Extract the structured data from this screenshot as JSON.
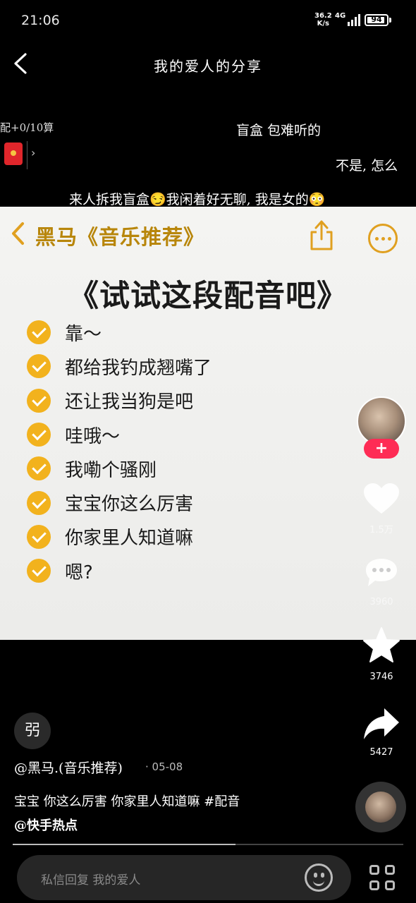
{
  "status_bar": {
    "time": "21:06",
    "net_speed": "36.2",
    "net_unit": "K/s",
    "network": "4G",
    "battery": "94",
    "battery_level": 0.94
  },
  "header": {
    "title": "我的爱人的分享"
  },
  "danmaku": {
    "redpack_count": "配+0/10算",
    "lines": [
      "盲盒 包难听的",
      "不是, 怎么",
      "来人拆我盲盒😏我闲着好无聊, 我是女的😳"
    ]
  },
  "card": {
    "title": "黑马《音乐推荐》",
    "headline": "《试试这段配音吧》",
    "items": [
      "靠～",
      "都给我钓成翘嘴了",
      "还让我当狗是吧",
      "哇哦～",
      "我嘞个骚刚",
      "宝宝你这么厉害",
      "你家里人知道嘛",
      "嗯?"
    ],
    "accent_color": "#f2b21d"
  },
  "rail": {
    "follow_label": "+",
    "likes": "1.5万",
    "comments": "3960",
    "favorites": "3746",
    "shares": "5427"
  },
  "info": {
    "sticker": "弜",
    "author": "@黑马.(音乐推荐)",
    "date": "· 05-08",
    "desc_line1": "宝宝 你这么厉害 你家里人知道嘛 #配音",
    "desc_line2": "@快手热点"
  },
  "progress": 0.57,
  "bottom": {
    "placeholder": "私信回复 我的爱人"
  }
}
